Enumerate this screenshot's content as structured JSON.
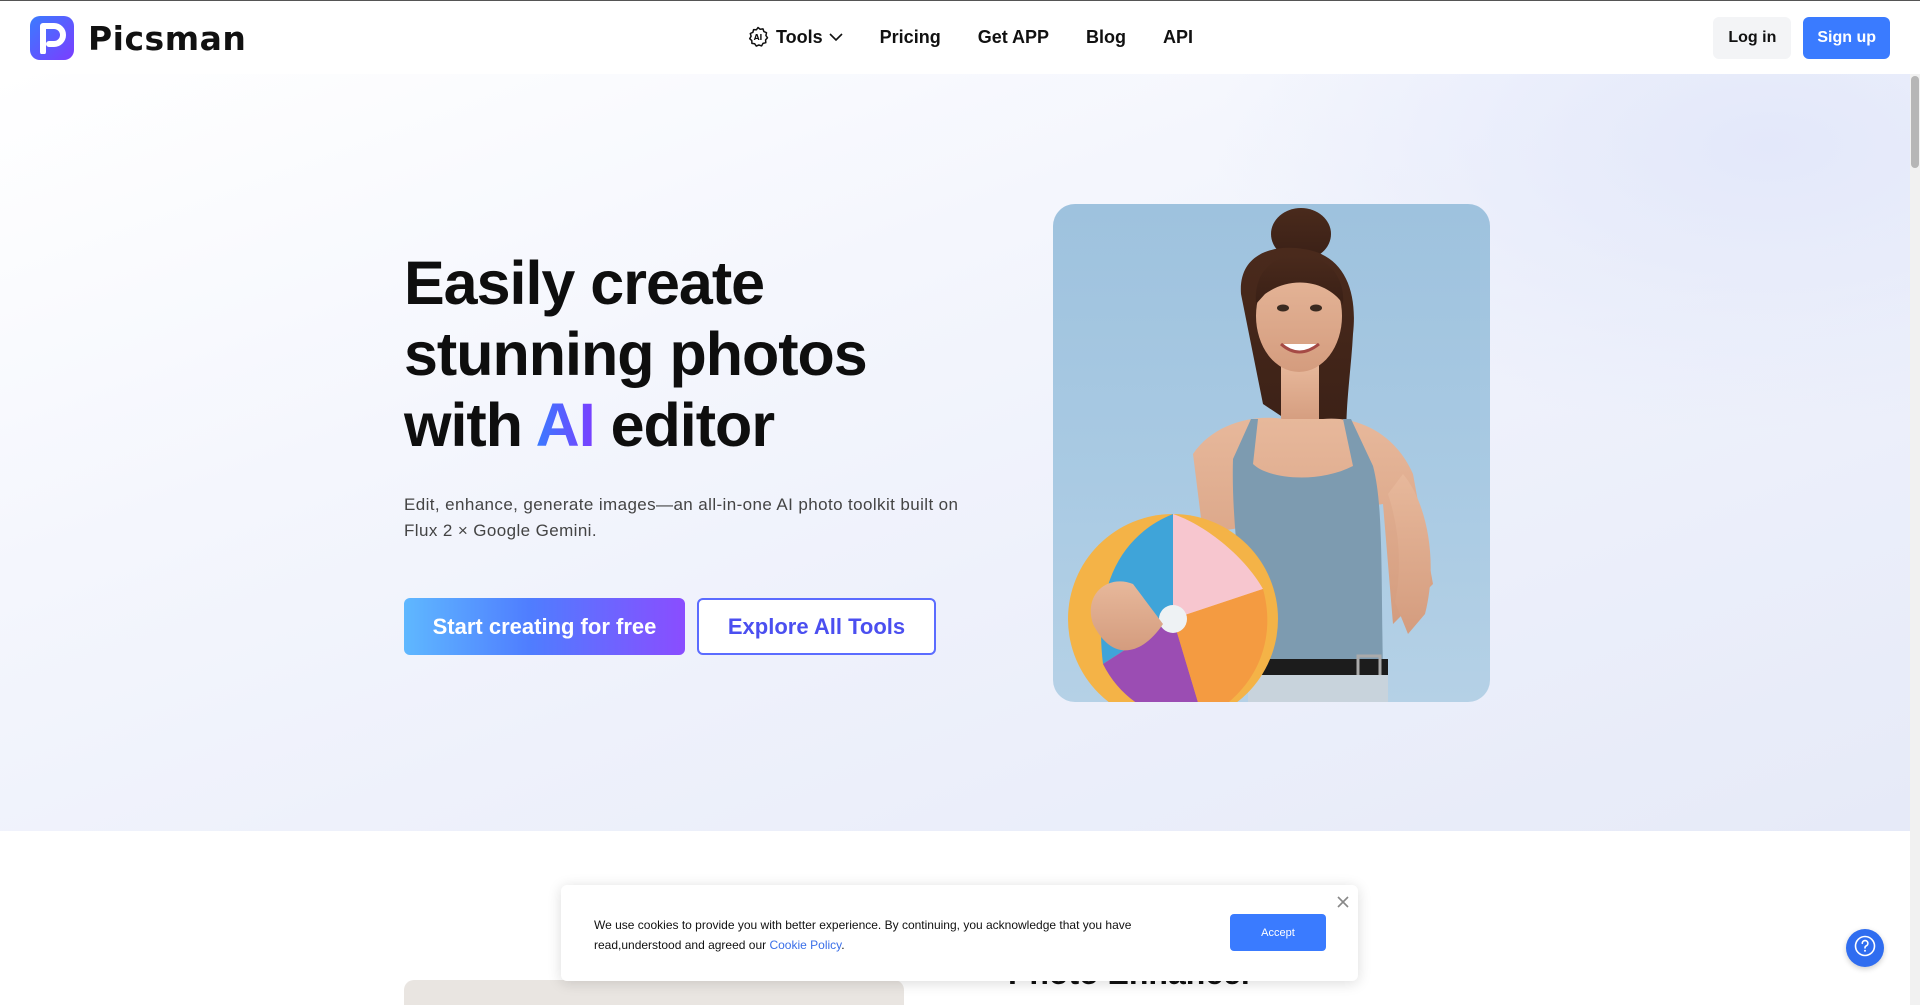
{
  "brand": {
    "name": "Picsman"
  },
  "nav": {
    "items": [
      {
        "label": "Tools",
        "icon": "ai-chip-icon",
        "has_dropdown": true
      },
      {
        "label": "Pricing"
      },
      {
        "label": "Get APP"
      },
      {
        "label": "Blog"
      },
      {
        "label": "API"
      }
    ]
  },
  "auth": {
    "login_label": "Log in",
    "signup_label": "Sign up"
  },
  "hero": {
    "headline_line1": "Easily create",
    "headline_line2": "stunning photos",
    "headline_prefix": "with ",
    "headline_accent": "AI",
    "headline_suffix": " editor",
    "subtext": "Edit, enhance, generate images—an all-in-one AI photo toolkit built on Flux 2 × Google Gemini.",
    "primary_cta": "Start creating for free",
    "secondary_cta": "Explore All Tools"
  },
  "section2": {
    "title": "Photo Enhancer"
  },
  "cookie": {
    "text": "We use cookies to provide you with better experience. By continuing, you acknowledge that you have read,understood and agreed our ",
    "link_label": "Cookie Policy",
    "text_end": ".",
    "accept_label": "Accept"
  },
  "colors": {
    "accent_blue": "#3a7bff",
    "accent_purple": "#7b3dff",
    "outline_button": "#5b6cff"
  }
}
